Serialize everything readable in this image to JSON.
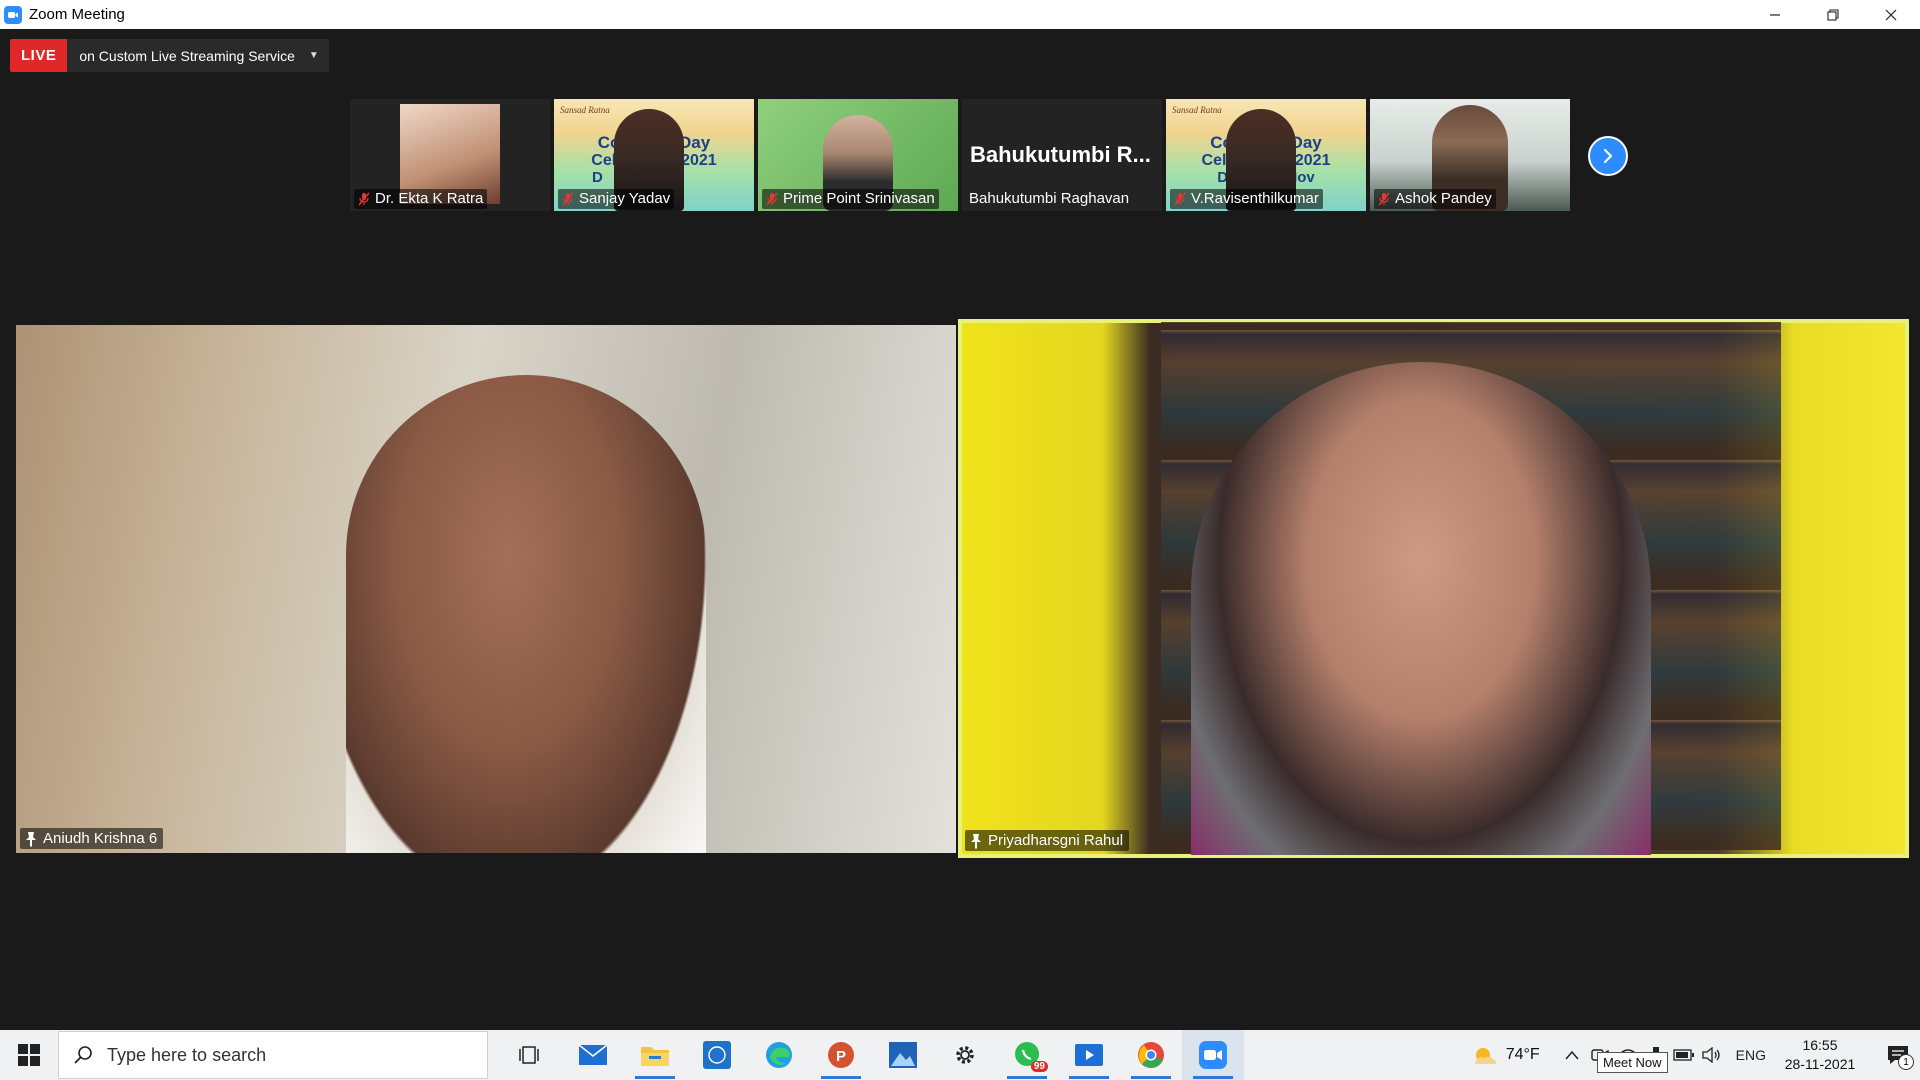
{
  "window": {
    "title": "Zoom Meeting"
  },
  "live": {
    "badge": "LIVE",
    "service": "on Custom Live Streaming Service"
  },
  "thumbnails": [
    {
      "name": "Dr. Ekta K Ratra",
      "muted": true,
      "kind": "portrait"
    },
    {
      "name": "Sanjay Yadav",
      "muted": true,
      "kind": "banner"
    },
    {
      "name": "Prime Point Srinivasan",
      "muted": true,
      "kind": "green"
    },
    {
      "name": "Bahukutumbi Raghavan",
      "display": "Bahukutumbi  R...",
      "muted": false,
      "kind": "name"
    },
    {
      "name": "V.Ravisenthilkumar",
      "muted": true,
      "kind": "banner"
    },
    {
      "name": "Ashok Pandey",
      "muted": true,
      "kind": "office"
    }
  ],
  "banner": {
    "brand": "Sansad Ratna",
    "line1a": "Const",
    "line1b": "Day",
    "line2a": "Celebr",
    "line2b": "s 2021",
    "line3": "D",
    "alt_line1a": "Cons",
    "alt_line1b": "Day",
    "alt_line2a": "Celeb",
    "alt_line2b": "ns 2021",
    "alt_line3a": "Day",
    "alt_line3b": "Nov"
  },
  "main_videos": [
    {
      "name": "Aniudh Krishna 6",
      "pinned": true,
      "active": false
    },
    {
      "name": "Priyadharsgni Rahul",
      "pinned": true,
      "active": true
    }
  ],
  "taskbar": {
    "search_placeholder": "Type here to search",
    "weather": "74°F",
    "language": "ENG",
    "time": "16:55",
    "date": "28-11-2021",
    "whatsapp_badge": "99",
    "notifications": "1",
    "tooltip": "Meet Now"
  },
  "colors": {
    "zoom_blue": "#2d8cff",
    "live_red": "#e02828",
    "active_border": "#e6f27a",
    "background": "#1a1a1a"
  }
}
